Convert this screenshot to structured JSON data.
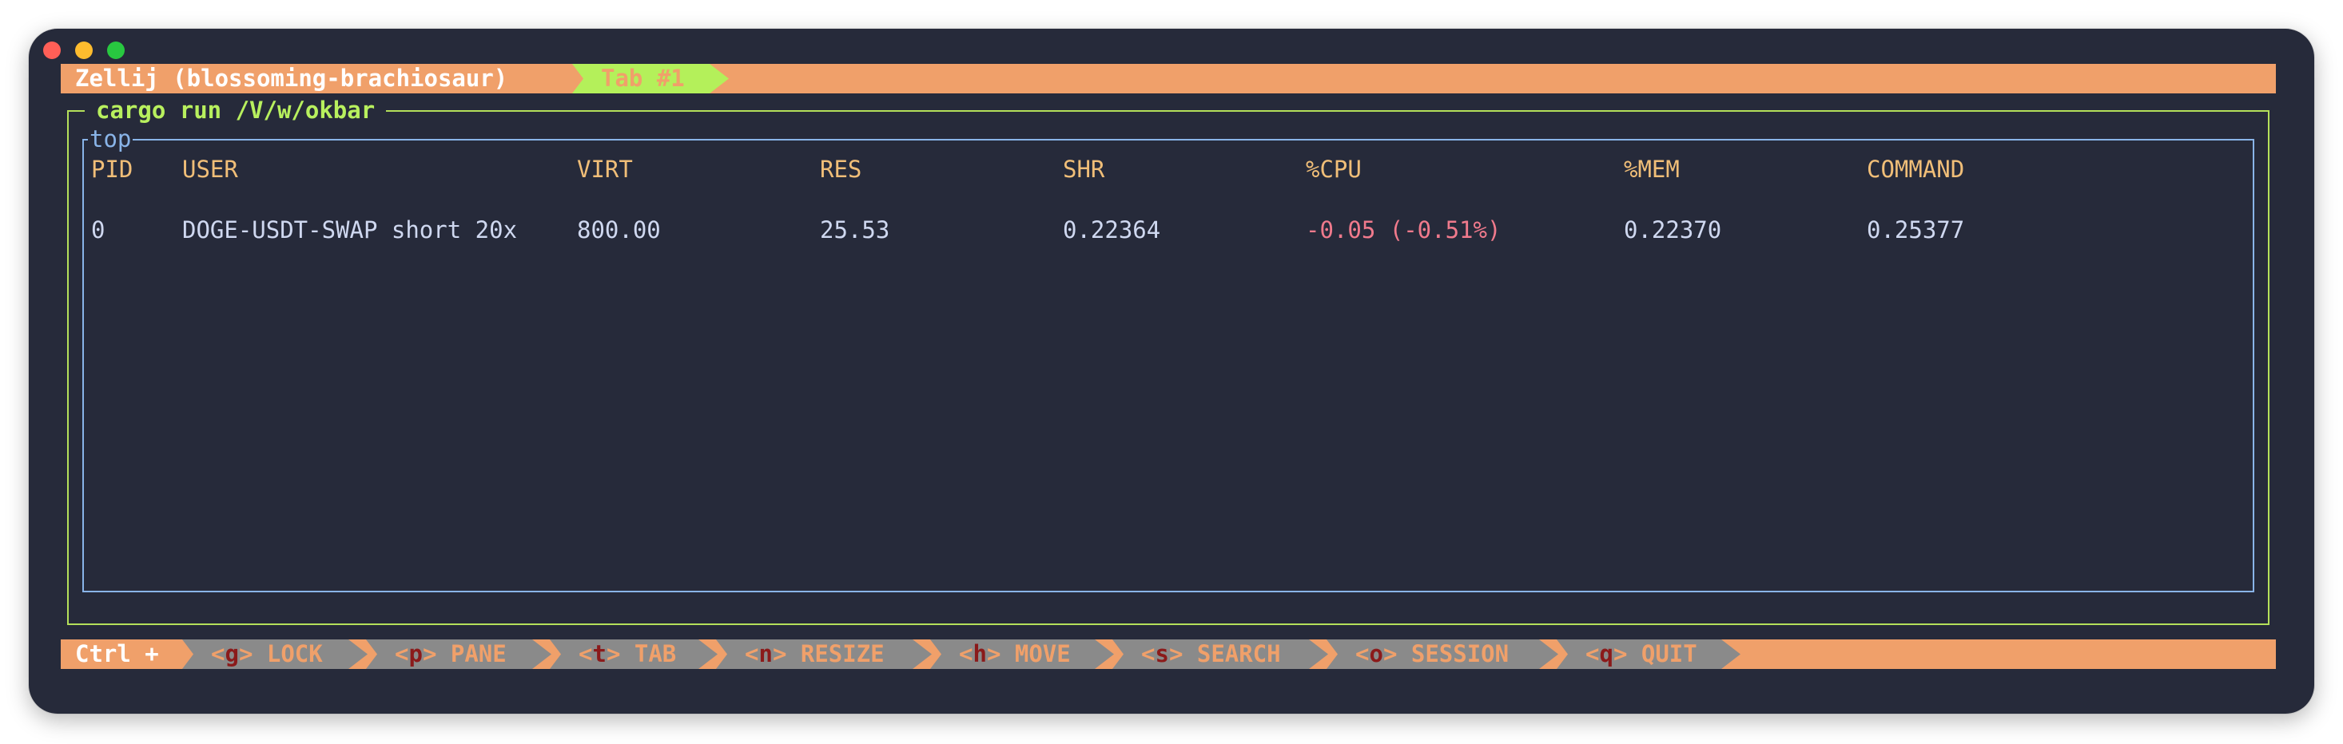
{
  "window": {
    "traffic_lights": [
      "close",
      "minimize",
      "maximize"
    ]
  },
  "tabbar": {
    "session_label": "Zellij (blossoming-brachiosaur)",
    "tabs": [
      {
        "label": "Tab #1",
        "active": true
      }
    ]
  },
  "pane": {
    "title": "cargo run /V/w/okbar",
    "inner_box_title": "top",
    "table": {
      "headers": [
        "PID",
        "USER",
        "VIRT",
        "RES",
        "SHR",
        "%CPU",
        "%MEM",
        "COMMAND"
      ],
      "rows": [
        [
          "0",
          "DOGE-USDT-SWAP short 20x",
          "800.00",
          "25.53",
          "0.22364",
          "-0.05 (-0.51%)",
          "0.22370",
          "0.25377"
        ]
      ]
    }
  },
  "statusbar": {
    "modifier_label": "Ctrl +",
    "items": [
      {
        "key": "g",
        "label": "LOCK"
      },
      {
        "key": "p",
        "label": "PANE"
      },
      {
        "key": "t",
        "label": "TAB"
      },
      {
        "key": "n",
        "label": "RESIZE"
      },
      {
        "key": "h",
        "label": "MOVE"
      },
      {
        "key": "s",
        "label": "SEARCH"
      },
      {
        "key": "o",
        "label": "SESSION"
      },
      {
        "key": "q",
        "label": "QUIT"
      }
    ]
  },
  "colors": {
    "background": "#262a3a",
    "bar_orange": "#f0a06a",
    "active_tab_green": "#b4f05a",
    "pane_border_green": "#b4e05a",
    "inner_border_blue": "#89b4e8",
    "header_text": "#f0be78",
    "cell_text": "#cfd8f0",
    "negative_text": "#f07a8c",
    "status_key": "#8b1a1a",
    "status_item_bg": "#8a8a8a"
  }
}
